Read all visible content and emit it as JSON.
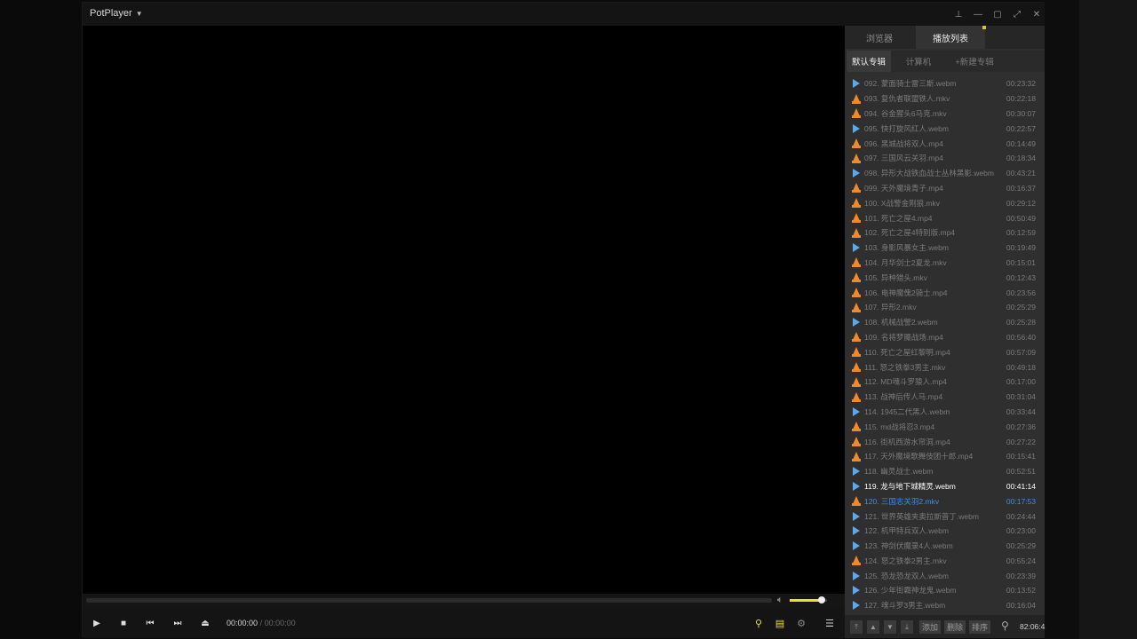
{
  "app": {
    "title": "PotPlayer"
  },
  "controls": {
    "time_current": "00:00:00",
    "time_sep": "/",
    "time_total": "00:00:00"
  },
  "volume": {
    "level": 0.85
  },
  "colors": {
    "accent_yellow": "#e9e22a",
    "selected_blue": "#3b8fe6",
    "webm_icon": "#5aa8ee",
    "vlc_icon": "#f0892b"
  },
  "panel": {
    "tabs": [
      {
        "label": "浏览器"
      },
      {
        "label": "播放列表"
      }
    ],
    "subtabs": [
      {
        "label": "默认专辑"
      },
      {
        "label": "计算机"
      },
      {
        "label": "+新建专辑"
      }
    ],
    "footer": {
      "add": "添加",
      "delete": "删除",
      "sort": "排序",
      "time": "82:06:4"
    }
  },
  "playlist": [
    {
      "icon": "play",
      "name": "092. 蒙面骑士雷三斯.webm",
      "dur": "00:23:32"
    },
    {
      "icon": "cone",
      "name": "093. 复仇者联盟铁人.mkv",
      "dur": "00:22:18"
    },
    {
      "icon": "cone",
      "name": "094. 谷金猩头6马克.mkv",
      "dur": "00:30:07"
    },
    {
      "icon": "play",
      "name": "095. 快打旋风红人.webm",
      "dur": "00:22:57"
    },
    {
      "icon": "cone",
      "name": "096. 黑城战将双人.mp4",
      "dur": "00:14:49"
    },
    {
      "icon": "cone",
      "name": "097. 三国风云关羽.mp4",
      "dur": "00:18:34"
    },
    {
      "icon": "play",
      "name": "098. 异形大战铁血战士丛林黑影.webm",
      "dur": "00:43:21"
    },
    {
      "icon": "cone",
      "name": "099. 天外魔境青子.mp4",
      "dur": "00:16:37"
    },
    {
      "icon": "cone",
      "name": "100. X战警金刚狼.mkv",
      "dur": "00:29:12"
    },
    {
      "icon": "cone",
      "name": "101. 死亡之屋4.mp4",
      "dur": "00:50:49"
    },
    {
      "icon": "cone",
      "name": "102. 死亡之屋4特别版.mp4",
      "dur": "00:12:59"
    },
    {
      "icon": "play",
      "name": "103. 身影风暴女主.webm",
      "dur": "00:19:49"
    },
    {
      "icon": "cone",
      "name": "104. 月华剑士2夏龙.mkv",
      "dur": "00:15:01"
    },
    {
      "icon": "cone",
      "name": "105. 异种猎头.mkv",
      "dur": "00:12:43"
    },
    {
      "icon": "cone",
      "name": "106. 电神魔傀2骑士.mp4",
      "dur": "00:23:56"
    },
    {
      "icon": "cone",
      "name": "107. 异形2.mkv",
      "dur": "00:25:29"
    },
    {
      "icon": "play",
      "name": "108. 机械战警2.webm",
      "dur": "00:25:28"
    },
    {
      "icon": "cone",
      "name": "109. 名将梦魇战场.mp4",
      "dur": "00:56:40"
    },
    {
      "icon": "cone",
      "name": "110. 死亡之屋红黎明.mp4",
      "dur": "00:57:09"
    },
    {
      "icon": "cone",
      "name": "111. 怒之铁拳3男主.mkv",
      "dur": "00:49:18"
    },
    {
      "icon": "cone",
      "name": "112. MD魂斗罗猿人.mp4",
      "dur": "00:17:00"
    },
    {
      "icon": "cone",
      "name": "113. 战神后传人马.mp4",
      "dur": "00:31:04"
    },
    {
      "icon": "play",
      "name": "114. 1945二代黑人.webm",
      "dur": "00:33:44"
    },
    {
      "icon": "cone",
      "name": "115. md战将忍3.mp4",
      "dur": "00:27:36"
    },
    {
      "icon": "cone",
      "name": "116. 街机西游水帘洞.mp4",
      "dur": "00:27:22"
    },
    {
      "icon": "cone",
      "name": "117. 天外魔境歌舞伎团十郎.mp4",
      "dur": "00:15:41"
    },
    {
      "icon": "play",
      "name": "118. 幽灵战士.webm",
      "dur": "00:52:51"
    },
    {
      "icon": "play",
      "name": "119. 龙与地下城精灵.webm",
      "dur": "00:41:14",
      "state": "current"
    },
    {
      "icon": "cone",
      "name": "120. 三国志关羽2.mkv",
      "dur": "00:17:53",
      "state": "selected"
    },
    {
      "icon": "play",
      "name": "121. 世界英雄夹奥拉斯普丁.webm",
      "dur": "00:24:44"
    },
    {
      "icon": "play",
      "name": "122. 机甲特兵双人.webm",
      "dur": "00:23:00"
    },
    {
      "icon": "play",
      "name": "123. 神剑伏魔录4人.webm",
      "dur": "00:25:29"
    },
    {
      "icon": "cone",
      "name": "124. 怒之铁拳2男主.mkv",
      "dur": "00:55:24"
    },
    {
      "icon": "play",
      "name": "125. 恐龙恐龙双人.webm",
      "dur": "00:23:39"
    },
    {
      "icon": "play",
      "name": "126. 少年街霸神龙鬼.webm",
      "dur": "00:13:52"
    },
    {
      "icon": "play",
      "name": "127. 魂斗罗3男主.webm",
      "dur": "00:16:04"
    }
  ]
}
